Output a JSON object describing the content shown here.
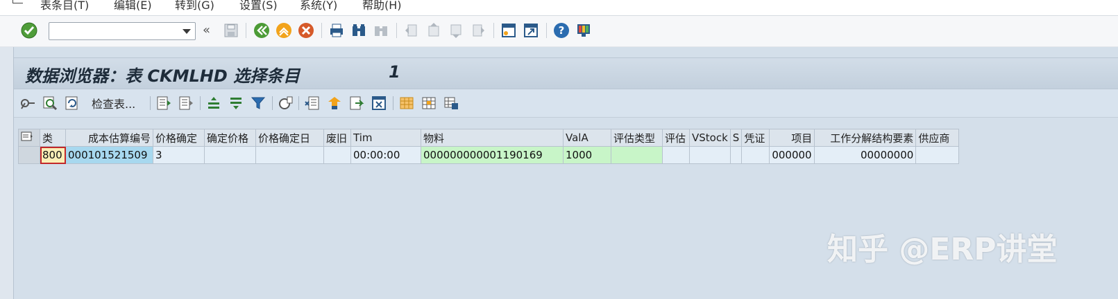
{
  "menu": {
    "items": [
      "表条目(T)",
      "编辑(E)",
      "转到(G)",
      "设置(S)",
      "系统(Y)",
      "帮助(H)"
    ]
  },
  "toolbar": {
    "command_field_value": "",
    "back_chevron": "«"
  },
  "title": {
    "text": "数据浏览器：表 CKMLHD 选择条目",
    "count": "1"
  },
  "app_toolbar": {
    "check_table_label": "检查表..."
  },
  "table": {
    "columns": [
      "类",
      "成本估算编号",
      "价格确定",
      "确定价格",
      "价格确定日",
      "废旧",
      "Tim",
      "物料",
      "ValA",
      "评估类型",
      "评估",
      "VStock",
      "S",
      "凭证",
      "项目",
      "工作分解结构要素",
      "供应商"
    ],
    "rows": [
      [
        "800",
        "000101521509",
        "3",
        "",
        "",
        "",
        "00:00:00",
        "000000000001190169",
        "1000",
        "",
        "",
        "",
        "",
        "",
        "000000",
        "00000000",
        ""
      ]
    ]
  },
  "watermark": "知乎 @ERP讲堂",
  "colors": {
    "key_highlight": "#fbefb7",
    "key_blue": "#a7d8ef",
    "green_field": "#c8f5c8",
    "frame_bg": "#d4dfea"
  }
}
